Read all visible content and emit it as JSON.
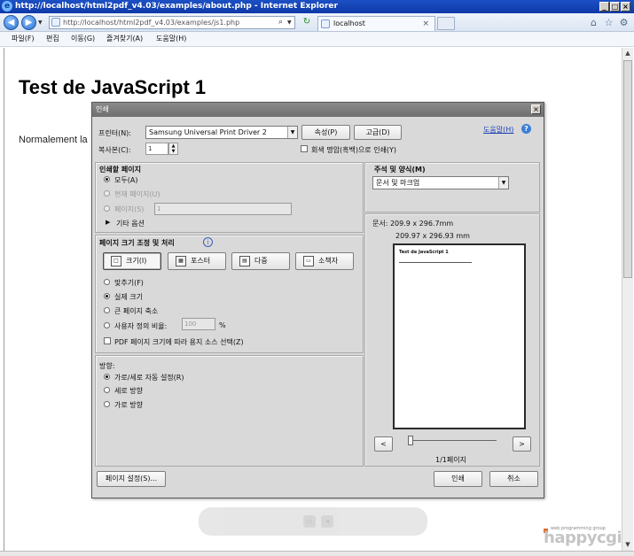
{
  "window": {
    "title": "http://localhost/html2pdf_v4.03/examples/about.php - Internet Explorer",
    "controls": [
      "_",
      "□",
      "×"
    ]
  },
  "navbar": {
    "address": "http://localhost/html2pdf_v4.03/examples/js1.php",
    "tab_title": "localhost"
  },
  "menu": [
    "파일(F)",
    "편집",
    "이동(G)",
    "즐겨찾기(A)",
    "도움말(H)"
  ],
  "page": {
    "heading": "Test de JavaScript 1",
    "paragraph": "Normalement la"
  },
  "dialog": {
    "title": "인쇄",
    "printer_label": "프린터(N):",
    "printer_value": "Samsung Universal Print Driver 2",
    "properties_button": "속성(P)",
    "advanced_button": "고급(D)",
    "help_link": "도움말(H)",
    "copies_label": "복사본(C):",
    "copies_value": "1",
    "grayscale_label": "회색 명암(흑백)으로 인쇄(Y)",
    "print_range": {
      "header": "인쇄할 페이지",
      "all": "모두(A)",
      "current": "현재 페이지(U)",
      "pages": "페이지(S)",
      "pages_value": "1",
      "more": "기타 옵션"
    },
    "comments": {
      "header": "주석 및 양식(M)",
      "value": "문서 및 마크업"
    },
    "sizing": {
      "header": "페이지 크기 조정 및 처리",
      "tiles": [
        "크기(I)",
        "포스터",
        "다중",
        "소책자"
      ],
      "fit": "맞추기(F)",
      "actual": "실제 크기",
      "shrink": "큰 페이지 축소",
      "custom_scale": "사용자 정의 비율:",
      "scale_value": "100",
      "percent": "%",
      "paper_source": "PDF 페이지 크기에 따라 용지 소스 선택(Z)"
    },
    "orientation": {
      "header": "방향:",
      "auto": "가로/세로 자동 설정(R)",
      "portrait": "세로 방향",
      "landscape": "가로 방향"
    },
    "preview": {
      "doc_size": "문서: 209.9 x 296.7mm",
      "paper_size": "209.97 x 296.93 mm",
      "sheet_title": "Test de JavaScript 1",
      "page_indicator": "1/1페이지",
      "prev": "<",
      "next": ">"
    },
    "page_setup_button": "페이지 설정(S)...",
    "print_button": "인쇄",
    "cancel_button": "취소"
  },
  "branding": {
    "tagline": "web programming group",
    "name": "happycgi"
  }
}
